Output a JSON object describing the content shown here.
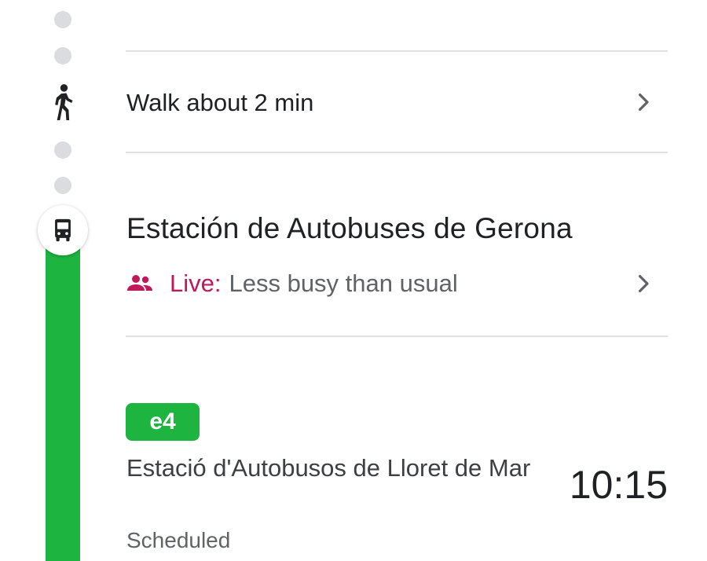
{
  "walk_step": {
    "label": "Walk about 2 min",
    "icon": "person-walking-icon"
  },
  "stop": {
    "name": "Estación de Autobuses de Gerona",
    "busyness_label": "Live:",
    "busyness_text": "Less busy than usual",
    "icon": "bus-icon"
  },
  "route": {
    "badge": "e4",
    "destination": "Estació d'Autobusos de Lloret de Mar",
    "departure_time": "10:15",
    "status": "Scheduled"
  },
  "colors": {
    "route_green": "#1db43f",
    "live_magenta": "#c2185b"
  }
}
